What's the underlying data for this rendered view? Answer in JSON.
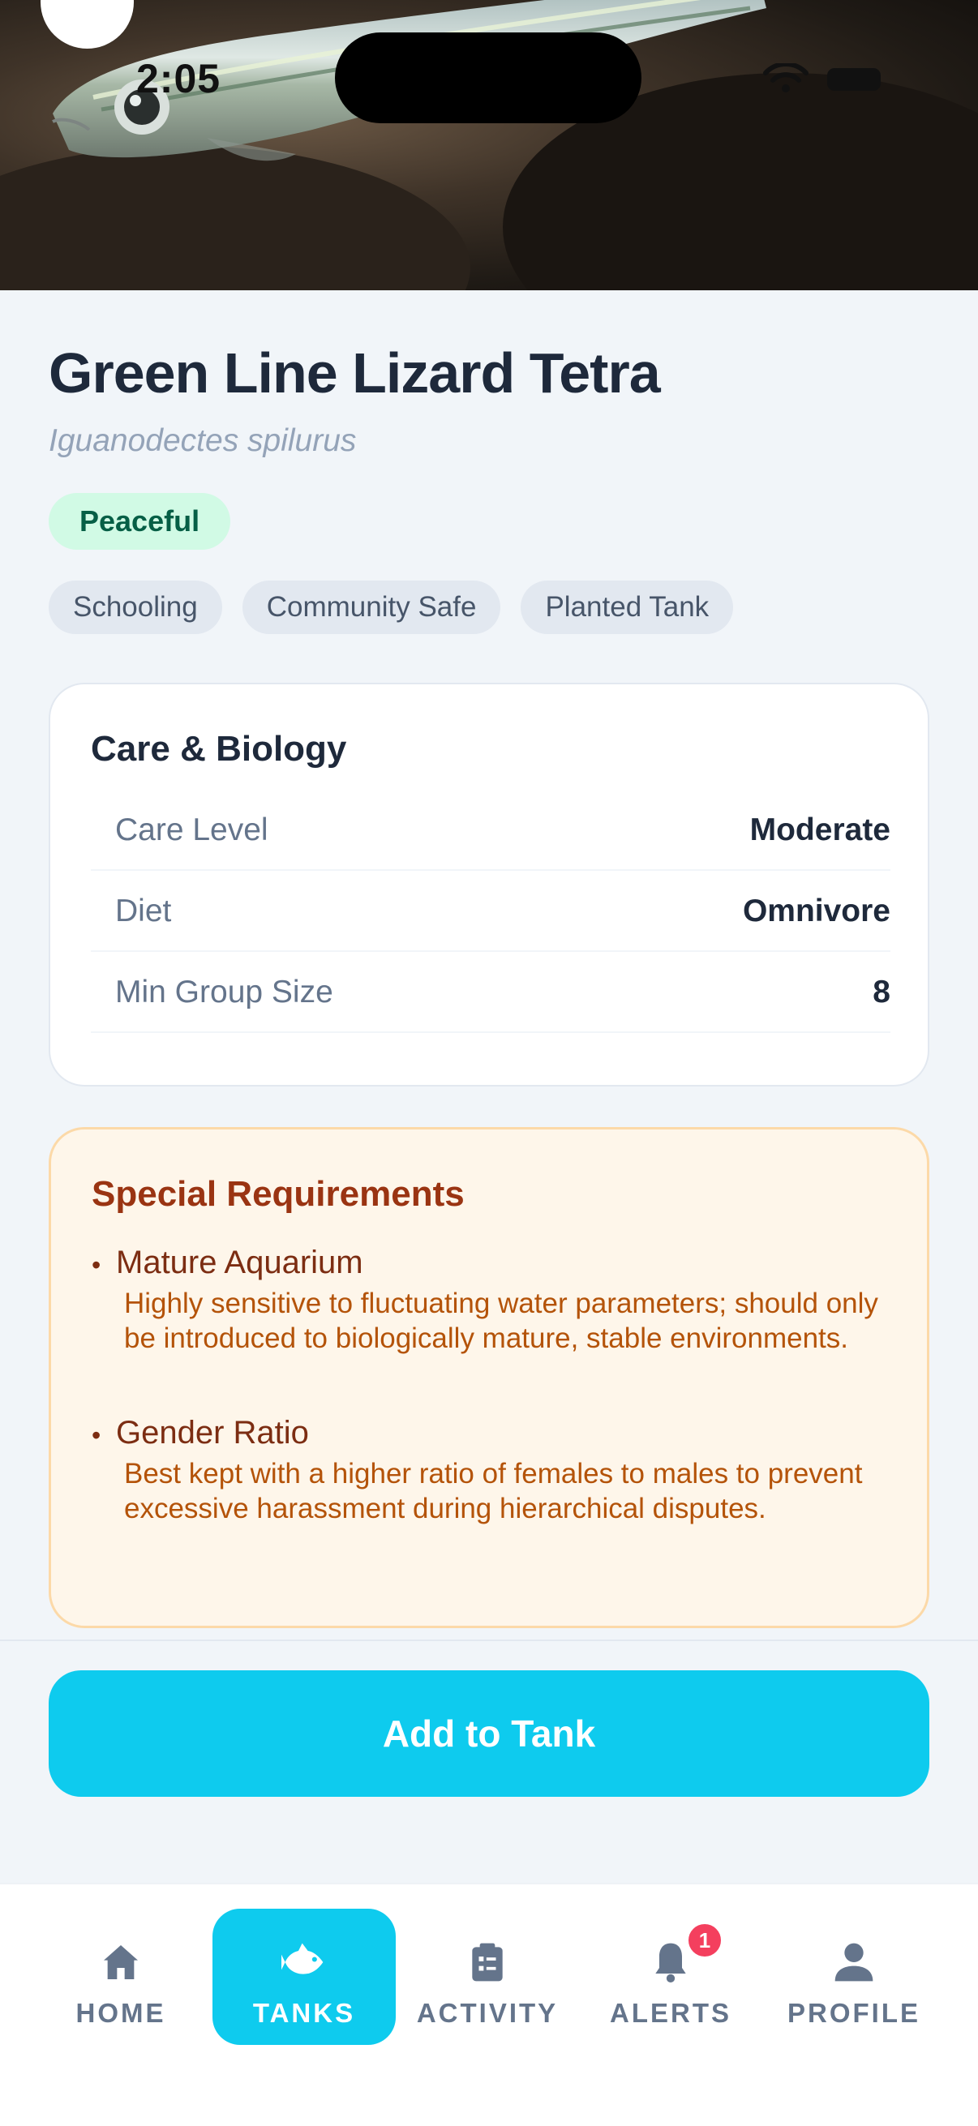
{
  "status": {
    "time": "2:05"
  },
  "species": {
    "common_name": "Green Line Lizard Tetra",
    "scientific_name": "Iguanodectes spilurus",
    "temperament": "Peaceful",
    "tags": [
      "Schooling",
      "Community Safe",
      "Planted Tank"
    ]
  },
  "care": {
    "title": "Care & Biology",
    "rows": [
      {
        "label": "Care Level",
        "value": "Moderate"
      },
      {
        "label": "Diet",
        "value": "Omnivore"
      },
      {
        "label": "Min Group Size",
        "value": "8"
      }
    ]
  },
  "requirements": {
    "title": "Special Requirements",
    "items": [
      {
        "title": "Mature Aquarium",
        "desc": "Highly sensitive to fluctuating water parameters; should only be introduced to biologically mature, stable environments."
      },
      {
        "title": "Gender Ratio",
        "desc": "Best kept with a higher ratio of females to males to prevent excessive harassment during hierarchical disputes."
      }
    ]
  },
  "cta": {
    "label": "Add to Tank"
  },
  "tabbar": {
    "items": [
      {
        "label": "HOME",
        "icon": "home-icon"
      },
      {
        "label": "TANKS",
        "icon": "fish-icon",
        "active": true
      },
      {
        "label": "ACTIVITY",
        "icon": "clipboard-icon"
      },
      {
        "label": "ALERTS",
        "icon": "bell-icon",
        "badge": "1"
      },
      {
        "label": "PROFILE",
        "icon": "person-icon"
      }
    ]
  },
  "colors": {
    "accent": "#0ecbee",
    "peaceful_bg": "#d1fae5",
    "peaceful_text": "#065f46",
    "requirements_bg": "#fef6ea",
    "requirements_title": "#9a3412",
    "badge": "#f43f5e"
  }
}
